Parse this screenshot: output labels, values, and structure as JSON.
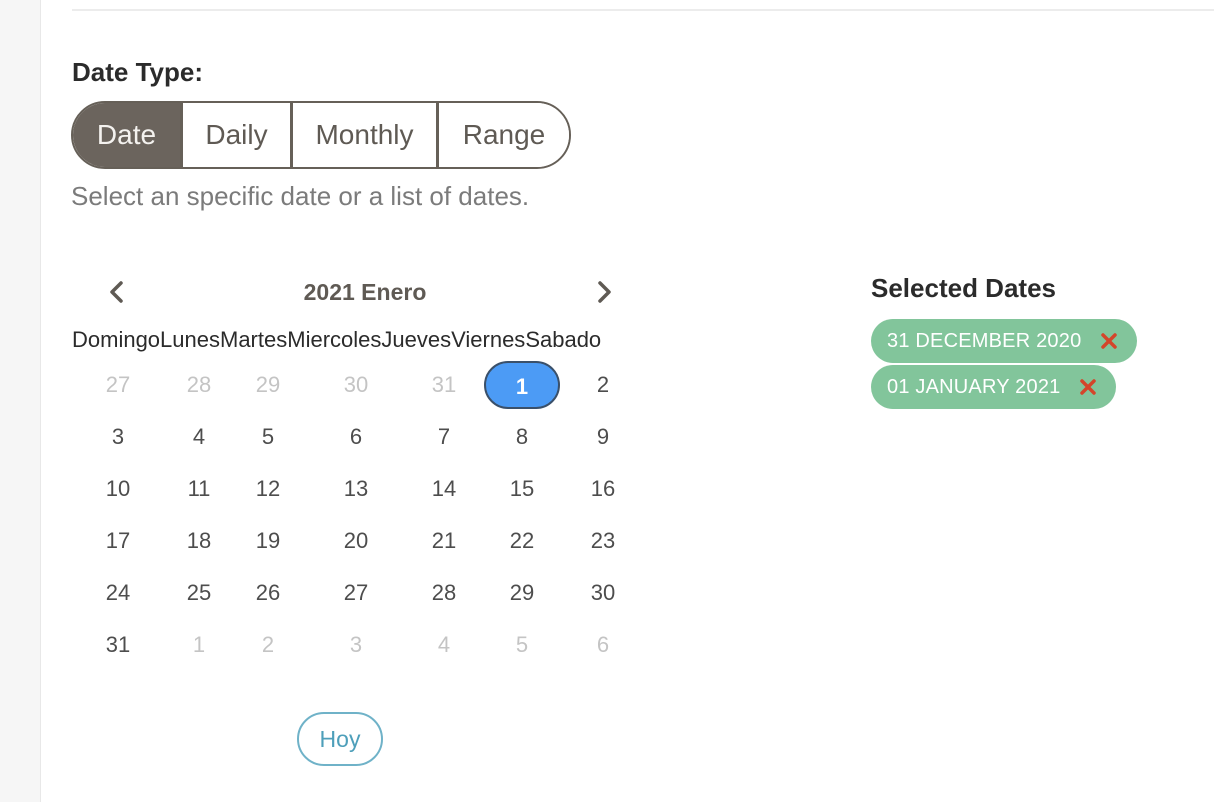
{
  "date_type": {
    "label": "Date Type:",
    "options": [
      "Date",
      "Daily",
      "Monthly",
      "Range"
    ],
    "active": "Date",
    "hint": "Select an specific date or a list of dates."
  },
  "calendar": {
    "title": "2021 Enero",
    "weekdays": [
      "Domingo",
      "Lunes",
      "Martes",
      "Miercoles",
      "Jueves",
      "Viernes",
      "Sabado"
    ],
    "weeks": [
      [
        {
          "d": "27",
          "m": true
        },
        {
          "d": "28",
          "m": true
        },
        {
          "d": "29",
          "m": true
        },
        {
          "d": "30",
          "m": true
        },
        {
          "d": "31",
          "m": true
        },
        {
          "d": "1",
          "s": true
        },
        {
          "d": "2"
        }
      ],
      [
        {
          "d": "3"
        },
        {
          "d": "4"
        },
        {
          "d": "5"
        },
        {
          "d": "6"
        },
        {
          "d": "7"
        },
        {
          "d": "8"
        },
        {
          "d": "9"
        }
      ],
      [
        {
          "d": "10"
        },
        {
          "d": "11"
        },
        {
          "d": "12"
        },
        {
          "d": "13"
        },
        {
          "d": "14"
        },
        {
          "d": "15"
        },
        {
          "d": "16"
        }
      ],
      [
        {
          "d": "17"
        },
        {
          "d": "18"
        },
        {
          "d": "19"
        },
        {
          "d": "20"
        },
        {
          "d": "21"
        },
        {
          "d": "22"
        },
        {
          "d": "23"
        }
      ],
      [
        {
          "d": "24"
        },
        {
          "d": "25"
        },
        {
          "d": "26"
        },
        {
          "d": "27"
        },
        {
          "d": "28"
        },
        {
          "d": "29"
        },
        {
          "d": "30"
        }
      ],
      [
        {
          "d": "31"
        },
        {
          "d": "1",
          "m": true
        },
        {
          "d": "2",
          "m": true
        },
        {
          "d": "3",
          "m": true
        },
        {
          "d": "4",
          "m": true
        },
        {
          "d": "5",
          "m": true
        },
        {
          "d": "6",
          "m": true
        }
      ]
    ],
    "today_label": "Hoy"
  },
  "selected": {
    "title": "Selected Dates",
    "items": [
      "31 DECEMBER 2020",
      "01 JANUARY 2021"
    ]
  },
  "colors": {
    "accent": "#4c9bf5",
    "segment_active": "#6b645d",
    "chip": "#82c59b",
    "remove": "#d4452a",
    "today": "#4e9fba"
  },
  "icons": {
    "prev": "chevron-left-icon",
    "next": "chevron-right-icon",
    "remove": "close-icon"
  }
}
